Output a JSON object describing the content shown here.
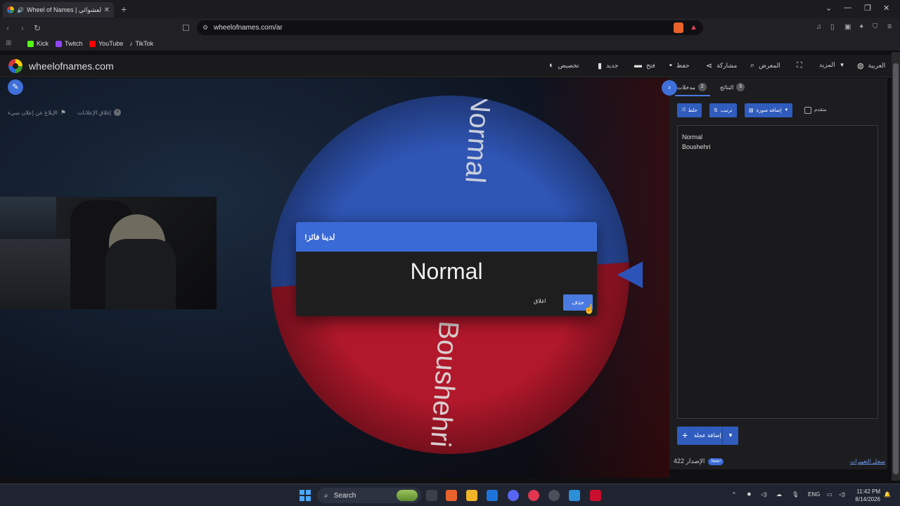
{
  "browser": {
    "tab_title": "Wheel of Names | عجلة الاسم العشوائي",
    "url": "wheelofnames.com/ar",
    "bookmarks": [
      "Kick",
      "Twitch",
      "YouTube",
      "TikTok"
    ]
  },
  "header": {
    "site_name": "wheelofnames.com",
    "nav": {
      "customize": "تخصيص",
      "new": "جديد",
      "open": "فتح",
      "save": "حفظ",
      "share": "مشاركة",
      "gallery": "المعرض",
      "more": "المزيد",
      "language": "العربية"
    }
  },
  "stage": {
    "close_ads": "إغلاق الإعلانات",
    "report_ad": "الإبلاغ عن إعلان سيء"
  },
  "wheel": {
    "segments": [
      {
        "label": "Normal",
        "color": "#2f55b5"
      },
      {
        "label": "Boushehri",
        "color": "#b2182b"
      }
    ]
  },
  "dialog": {
    "title": "لدينا فائز!",
    "winner": "Normal",
    "close_label": "اغلاق",
    "remove_label": "حذف"
  },
  "sidebar": {
    "tabs": [
      {
        "label": "مدخلات",
        "count": "2"
      },
      {
        "label": "النتائج",
        "count": "5"
      }
    ],
    "buttons": {
      "shuffle": "خلط",
      "sort": "ترتيب",
      "add_image": "إضافة صورة",
      "advanced": "متقدم"
    },
    "entries": [
      "Normal",
      "Boushehri"
    ],
    "add_wheel": "إضافة عجلة",
    "version_label": "الإصدار 422",
    "new_badge": "New!",
    "changelog": "سجل التغييرات"
  },
  "taskbar": {
    "search_placeholder": "Search",
    "language": "ENG",
    "time": "11:42 PM",
    "date": "8/14/2026"
  },
  "colors": {
    "accent": "#3a6ad6",
    "wheel_blue": "#2f55b5",
    "wheel_red": "#b2182b"
  }
}
